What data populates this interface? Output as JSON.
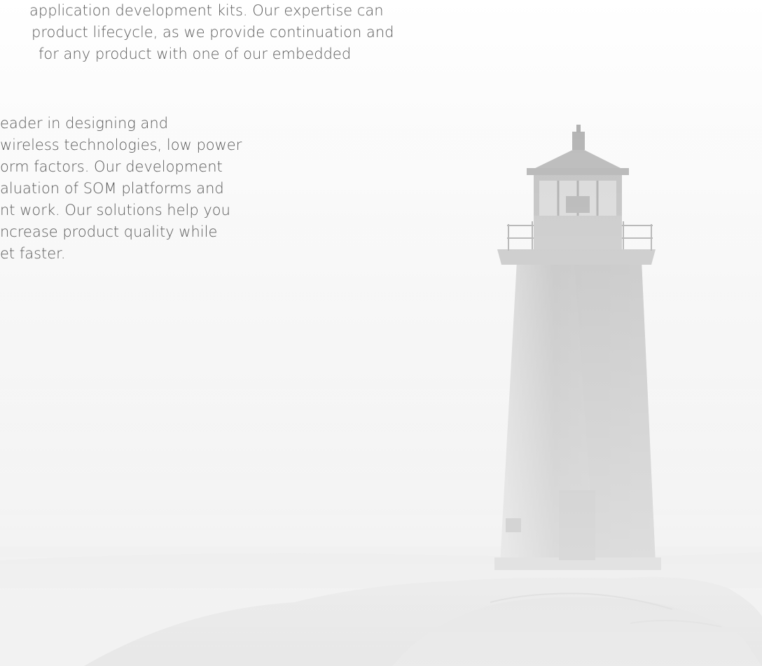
{
  "paragraph_1": {
    "lines": [
      "application development kits. Our expertise can",
      "product lifecycle, as we provide continuation and",
      "for any product with one of our embedded"
    ]
  },
  "paragraph_2": {
    "lines": [
      "eader in designing and",
      "wireless technologies, low power",
      "orm factors. Our development",
      "aluation of SOM platforms and",
      "nt work. Our solutions help you",
      "ncrease product quality while",
      "et faster."
    ]
  },
  "colors": {
    "text": "#5b5b5b",
    "background": "#f4f4f4",
    "lighthouse": "#cfcfcf"
  },
  "background_image": {
    "icon": "lighthouse-illustration"
  }
}
